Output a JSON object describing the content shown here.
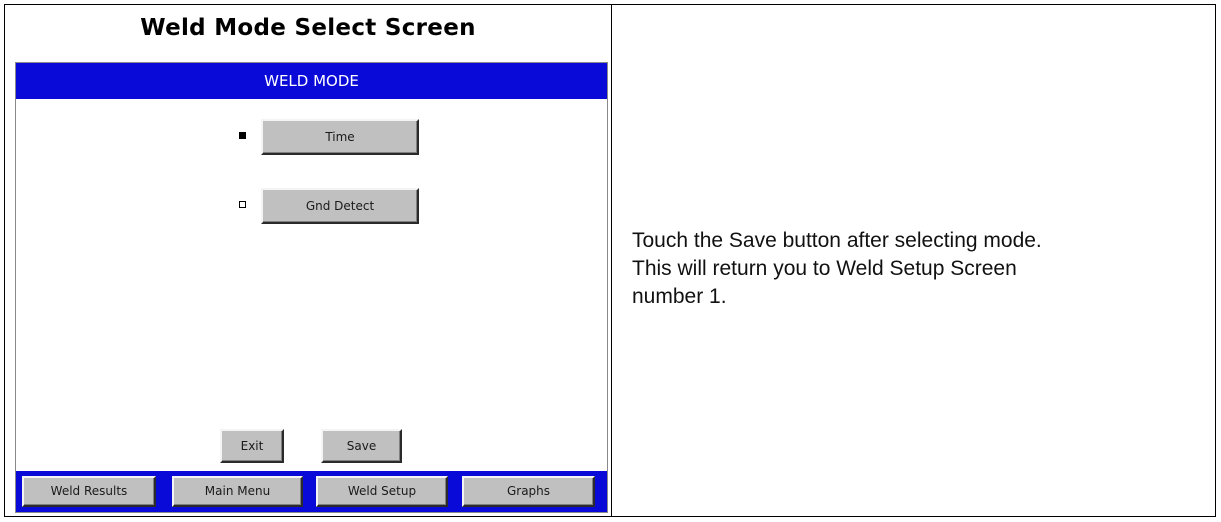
{
  "section_title": "Weld Mode Select Screen",
  "screen": {
    "header": "WELD MODE",
    "modes": [
      {
        "label": "Time",
        "selected": true
      },
      {
        "label": "Gnd Detect",
        "selected": false
      }
    ],
    "exit_label": "Exit",
    "save_label": "Save",
    "bottom_nav": [
      "Weld Results",
      "Main Menu",
      "Weld Setup",
      "Graphs"
    ],
    "header_color": "#0a0ad8",
    "button_color": "#c0c0c0"
  },
  "note": {
    "lines": [
      "Touch the Save button after selecting mode.",
      "This will return you to Weld Setup Screen",
      "number 1."
    ]
  }
}
